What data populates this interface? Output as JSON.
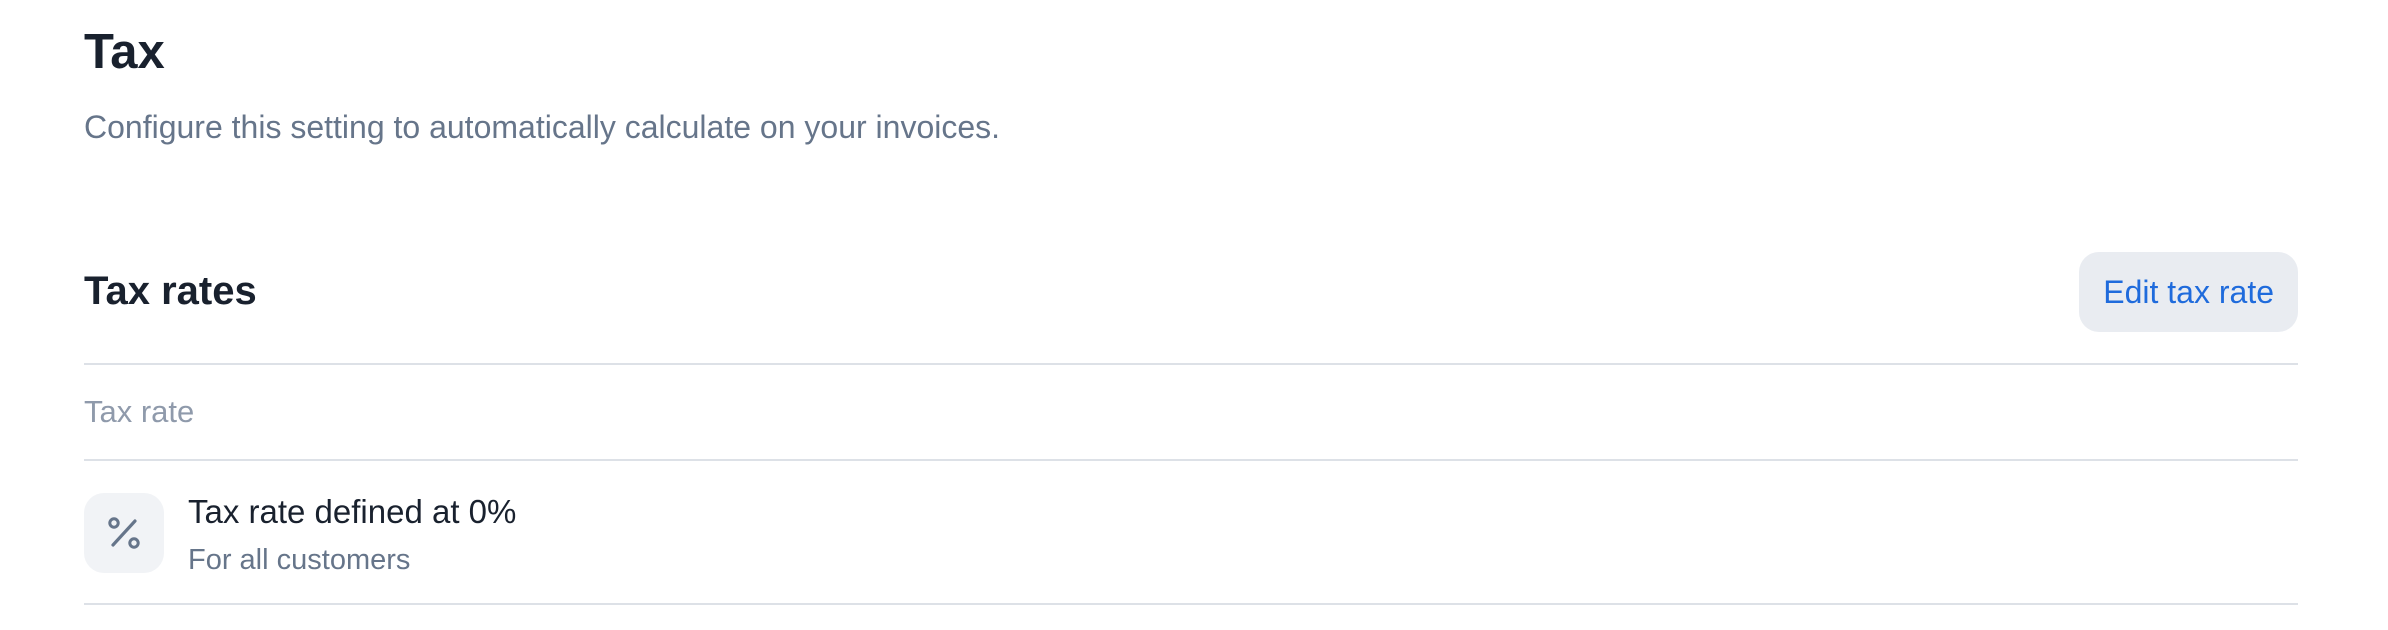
{
  "page": {
    "title": "Tax",
    "subtitle": "Configure this setting to automatically calculate on your invoices."
  },
  "tax_rates": {
    "section_title": "Tax rates",
    "edit_button_label": "Edit tax rate",
    "column_header": "Tax rate",
    "rows": [
      {
        "icon": "percent-icon",
        "title": "Tax rate defined at 0%",
        "subtitle": "For all customers"
      }
    ]
  },
  "colors": {
    "heading": "#19212e",
    "muted_text": "#66758a",
    "column_header": "#8f9aab",
    "link_blue": "#1f6bdc",
    "button_bg": "#e9ecf1",
    "divider": "#dde1e7",
    "icon_bg": "#f1f3f6"
  }
}
